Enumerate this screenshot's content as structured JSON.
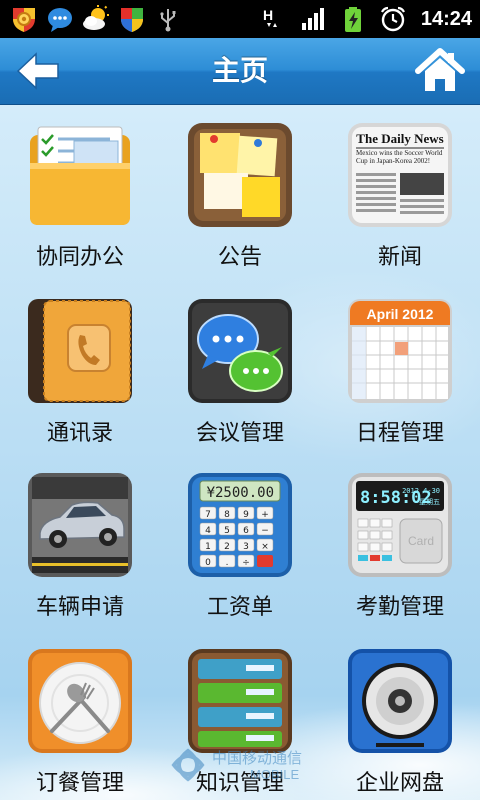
{
  "status_bar": {
    "time": "14:24",
    "left_icons": [
      "settings-shield-icon",
      "chat-bubble-icon",
      "weather-sun-cloud-icon",
      "windows-shield-icon",
      "usb-icon"
    ],
    "right_icons": [
      "network-h-icon",
      "signal-bars-icon",
      "battery-charging-icon",
      "alarm-clock-icon"
    ]
  },
  "header": {
    "title": "主页",
    "back_icon": "back-arrow-icon",
    "home_icon": "home-icon",
    "color": "#2a88d2"
  },
  "apps": [
    {
      "label": "协同办公",
      "icon": "folder-documents-icon"
    },
    {
      "label": "公告",
      "icon": "notice-board-icon"
    },
    {
      "label": "新闻",
      "icon": "newspaper-icon"
    },
    {
      "label": "通讯录",
      "icon": "address-book-icon"
    },
    {
      "label": "会议管理",
      "icon": "meeting-chat-icon"
    },
    {
      "label": "日程管理",
      "icon": "calendar-icon"
    },
    {
      "label": "车辆申请",
      "icon": "car-icon"
    },
    {
      "label": "工资单",
      "icon": "calculator-icon"
    },
    {
      "label": "考勤管理",
      "icon": "time-clock-icon"
    },
    {
      "label": "订餐管理",
      "icon": "dining-plate-icon"
    },
    {
      "label": "知识管理",
      "icon": "bookshelf-icon"
    },
    {
      "label": "企业网盘",
      "icon": "disk-drive-icon"
    }
  ],
  "icon_text": {
    "newspaper_title": "The Daily News",
    "newspaper_headline": "Mexico wins the Soccer World Cup in Japan-Korea 2002!",
    "calendar_month": "April  2012",
    "calculator_display": "¥2500.00",
    "clock_time": "8:58:02",
    "clock_date": "2012  4-30",
    "clock_weekday": "星期五",
    "card_label": "Card"
  },
  "watermark": {
    "text_cn": "中国移动通信",
    "text_en": "MOBILE"
  }
}
